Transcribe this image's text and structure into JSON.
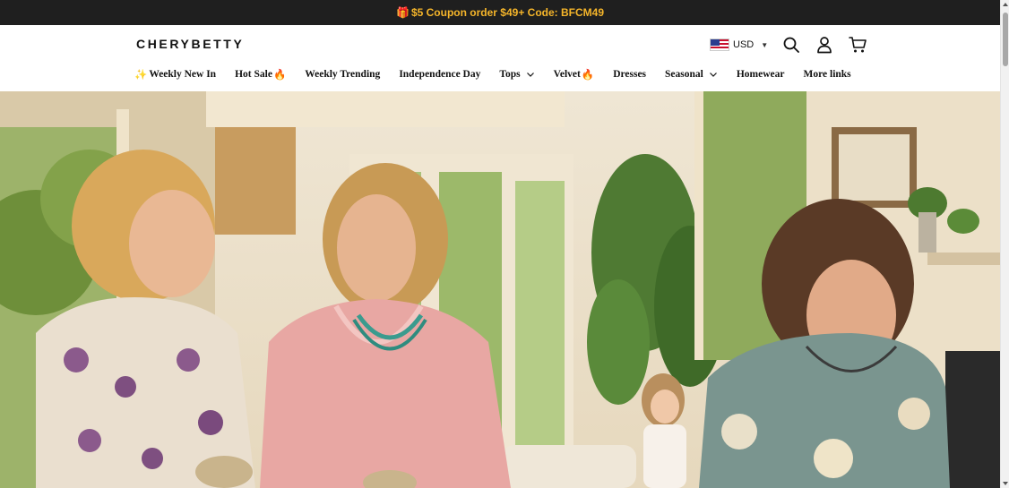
{
  "announcement": {
    "text": "$5 Coupon order $49+ Code: BFCM49"
  },
  "header": {
    "logo": "CHERYBETTY",
    "currency": "USD",
    "icons": [
      "search-icon",
      "account-icon",
      "cart-icon"
    ]
  },
  "nav": {
    "items": [
      {
        "label": "Weekly New In",
        "prefix_icon": "sparkle"
      },
      {
        "label": "Hot Sale",
        "suffix_icon": "fire"
      },
      {
        "label": "Weekly Trending"
      },
      {
        "label": "Independence Day"
      },
      {
        "label": "Tops",
        "dropdown": true
      },
      {
        "label": "Velvet",
        "suffix_icon": "fire"
      },
      {
        "label": "Dresses"
      },
      {
        "label": "Seasonal",
        "dropdown": true
      },
      {
        "label": "Homewear"
      },
      {
        "label": "More links"
      }
    ]
  },
  "colors": {
    "announcement_bg": "#1f1f1f",
    "announcement_text": "#f5b52a",
    "text": "#111111"
  }
}
